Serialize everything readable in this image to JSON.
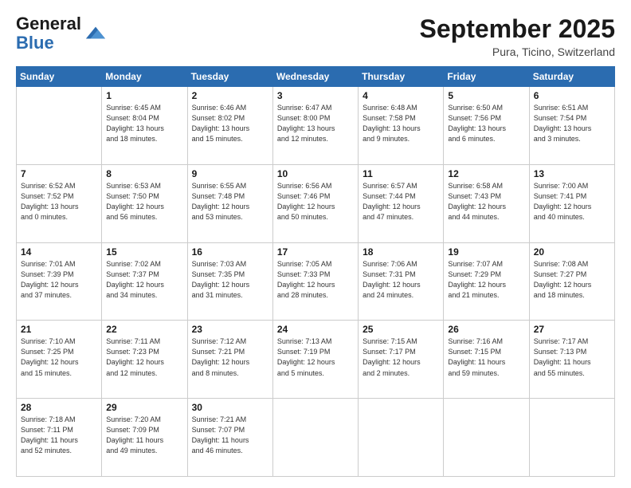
{
  "logo": {
    "line1": "General",
    "line2": "Blue"
  },
  "header": {
    "month_year": "September 2025",
    "location": "Pura, Ticino, Switzerland"
  },
  "weekdays": [
    "Sunday",
    "Monday",
    "Tuesday",
    "Wednesday",
    "Thursday",
    "Friday",
    "Saturday"
  ],
  "weeks": [
    [
      {
        "day": "",
        "info": ""
      },
      {
        "day": "1",
        "info": "Sunrise: 6:45 AM\nSunset: 8:04 PM\nDaylight: 13 hours\nand 18 minutes."
      },
      {
        "day": "2",
        "info": "Sunrise: 6:46 AM\nSunset: 8:02 PM\nDaylight: 13 hours\nand 15 minutes."
      },
      {
        "day": "3",
        "info": "Sunrise: 6:47 AM\nSunset: 8:00 PM\nDaylight: 13 hours\nand 12 minutes."
      },
      {
        "day": "4",
        "info": "Sunrise: 6:48 AM\nSunset: 7:58 PM\nDaylight: 13 hours\nand 9 minutes."
      },
      {
        "day": "5",
        "info": "Sunrise: 6:50 AM\nSunset: 7:56 PM\nDaylight: 13 hours\nand 6 minutes."
      },
      {
        "day": "6",
        "info": "Sunrise: 6:51 AM\nSunset: 7:54 PM\nDaylight: 13 hours\nand 3 minutes."
      }
    ],
    [
      {
        "day": "7",
        "info": "Sunrise: 6:52 AM\nSunset: 7:52 PM\nDaylight: 13 hours\nand 0 minutes."
      },
      {
        "day": "8",
        "info": "Sunrise: 6:53 AM\nSunset: 7:50 PM\nDaylight: 12 hours\nand 56 minutes."
      },
      {
        "day": "9",
        "info": "Sunrise: 6:55 AM\nSunset: 7:48 PM\nDaylight: 12 hours\nand 53 minutes."
      },
      {
        "day": "10",
        "info": "Sunrise: 6:56 AM\nSunset: 7:46 PM\nDaylight: 12 hours\nand 50 minutes."
      },
      {
        "day": "11",
        "info": "Sunrise: 6:57 AM\nSunset: 7:44 PM\nDaylight: 12 hours\nand 47 minutes."
      },
      {
        "day": "12",
        "info": "Sunrise: 6:58 AM\nSunset: 7:43 PM\nDaylight: 12 hours\nand 44 minutes."
      },
      {
        "day": "13",
        "info": "Sunrise: 7:00 AM\nSunset: 7:41 PM\nDaylight: 12 hours\nand 40 minutes."
      }
    ],
    [
      {
        "day": "14",
        "info": "Sunrise: 7:01 AM\nSunset: 7:39 PM\nDaylight: 12 hours\nand 37 minutes."
      },
      {
        "day": "15",
        "info": "Sunrise: 7:02 AM\nSunset: 7:37 PM\nDaylight: 12 hours\nand 34 minutes."
      },
      {
        "day": "16",
        "info": "Sunrise: 7:03 AM\nSunset: 7:35 PM\nDaylight: 12 hours\nand 31 minutes."
      },
      {
        "day": "17",
        "info": "Sunrise: 7:05 AM\nSunset: 7:33 PM\nDaylight: 12 hours\nand 28 minutes."
      },
      {
        "day": "18",
        "info": "Sunrise: 7:06 AM\nSunset: 7:31 PM\nDaylight: 12 hours\nand 24 minutes."
      },
      {
        "day": "19",
        "info": "Sunrise: 7:07 AM\nSunset: 7:29 PM\nDaylight: 12 hours\nand 21 minutes."
      },
      {
        "day": "20",
        "info": "Sunrise: 7:08 AM\nSunset: 7:27 PM\nDaylight: 12 hours\nand 18 minutes."
      }
    ],
    [
      {
        "day": "21",
        "info": "Sunrise: 7:10 AM\nSunset: 7:25 PM\nDaylight: 12 hours\nand 15 minutes."
      },
      {
        "day": "22",
        "info": "Sunrise: 7:11 AM\nSunset: 7:23 PM\nDaylight: 12 hours\nand 12 minutes."
      },
      {
        "day": "23",
        "info": "Sunrise: 7:12 AM\nSunset: 7:21 PM\nDaylight: 12 hours\nand 8 minutes."
      },
      {
        "day": "24",
        "info": "Sunrise: 7:13 AM\nSunset: 7:19 PM\nDaylight: 12 hours\nand 5 minutes."
      },
      {
        "day": "25",
        "info": "Sunrise: 7:15 AM\nSunset: 7:17 PM\nDaylight: 12 hours\nand 2 minutes."
      },
      {
        "day": "26",
        "info": "Sunrise: 7:16 AM\nSunset: 7:15 PM\nDaylight: 11 hours\nand 59 minutes."
      },
      {
        "day": "27",
        "info": "Sunrise: 7:17 AM\nSunset: 7:13 PM\nDaylight: 11 hours\nand 55 minutes."
      }
    ],
    [
      {
        "day": "28",
        "info": "Sunrise: 7:18 AM\nSunset: 7:11 PM\nDaylight: 11 hours\nand 52 minutes."
      },
      {
        "day": "29",
        "info": "Sunrise: 7:20 AM\nSunset: 7:09 PM\nDaylight: 11 hours\nand 49 minutes."
      },
      {
        "day": "30",
        "info": "Sunrise: 7:21 AM\nSunset: 7:07 PM\nDaylight: 11 hours\nand 46 minutes."
      },
      {
        "day": "",
        "info": ""
      },
      {
        "day": "",
        "info": ""
      },
      {
        "day": "",
        "info": ""
      },
      {
        "day": "",
        "info": ""
      }
    ]
  ]
}
